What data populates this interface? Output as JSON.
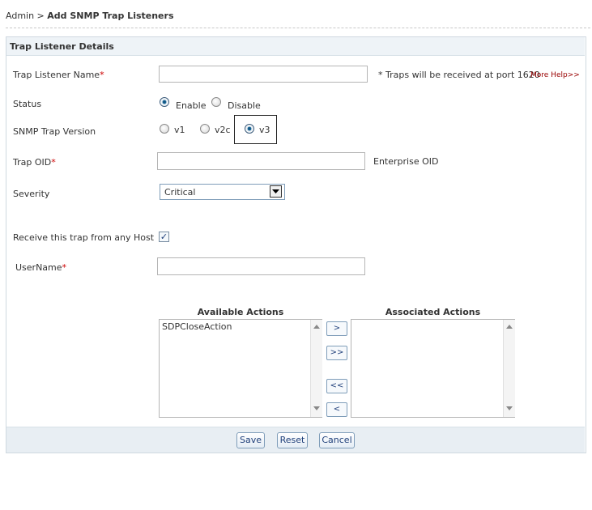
{
  "breadcrumb": {
    "root": "Admin",
    "separator": " > ",
    "current": "Add SNMP Trap Listeners"
  },
  "panel": {
    "title": "Trap Listener Details"
  },
  "form": {
    "name": {
      "label": "Trap Listener Name",
      "required_mark": "*",
      "value": "",
      "note": "* Traps will be received at port 1620",
      "help_link": "More Help>>"
    },
    "status": {
      "label": "Status",
      "options": [
        "Enable",
        "Disable"
      ],
      "selected": "Enable"
    },
    "version": {
      "label": "SNMP Trap Version",
      "options": [
        "v1",
        "v2c",
        "v3"
      ],
      "selected": "v3"
    },
    "trap_oid": {
      "label": "Trap OID",
      "required_mark": "*",
      "value": "",
      "note": "Enterprise OID"
    },
    "severity": {
      "label": "Severity",
      "value": "Critical"
    },
    "any_host": {
      "label": "Receive this trap from any Host",
      "checked": true,
      "check_glyph": "✓"
    },
    "username": {
      "label": "UserName",
      "required_mark": "*",
      "value": ""
    }
  },
  "actions": {
    "available_header": "Available Actions",
    "associated_header": "Associated Actions",
    "available_items": [
      "SDPCloseAction"
    ],
    "associated_items": [],
    "move_one_right": ">",
    "move_all_right": ">>",
    "move_all_left": "<<",
    "move_one_left": "<"
  },
  "footer": {
    "save": "Save",
    "reset": "Reset",
    "cancel": "Cancel"
  },
  "colors": {
    "required": "#cc0000",
    "help_link": "#990000",
    "panel_header_bg": "#eef3f7",
    "footer_bg": "#e8eef3"
  }
}
